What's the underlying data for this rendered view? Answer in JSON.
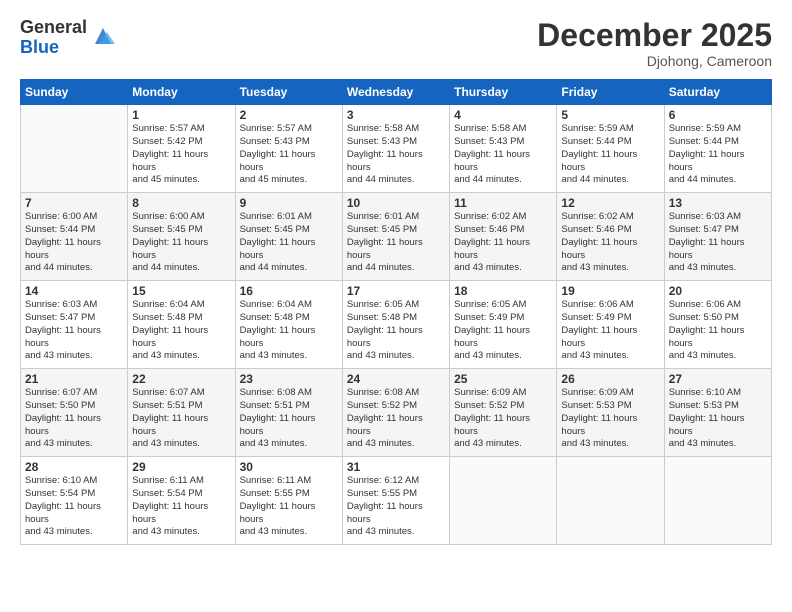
{
  "header": {
    "logo_general": "General",
    "logo_blue": "Blue",
    "month_title": "December 2025",
    "location": "Djohong, Cameroon"
  },
  "days_of_week": [
    "Sunday",
    "Monday",
    "Tuesday",
    "Wednesday",
    "Thursday",
    "Friday",
    "Saturday"
  ],
  "weeks": [
    [
      {
        "day": "",
        "sunrise": "",
        "sunset": "",
        "daylight": ""
      },
      {
        "day": "1",
        "sunrise": "Sunrise: 5:57 AM",
        "sunset": "Sunset: 5:42 PM",
        "daylight": "Daylight: 11 hours and 45 minutes."
      },
      {
        "day": "2",
        "sunrise": "Sunrise: 5:57 AM",
        "sunset": "Sunset: 5:43 PM",
        "daylight": "Daylight: 11 hours and 45 minutes."
      },
      {
        "day": "3",
        "sunrise": "Sunrise: 5:58 AM",
        "sunset": "Sunset: 5:43 PM",
        "daylight": "Daylight: 11 hours and 44 minutes."
      },
      {
        "day": "4",
        "sunrise": "Sunrise: 5:58 AM",
        "sunset": "Sunset: 5:43 PM",
        "daylight": "Daylight: 11 hours and 44 minutes."
      },
      {
        "day": "5",
        "sunrise": "Sunrise: 5:59 AM",
        "sunset": "Sunset: 5:44 PM",
        "daylight": "Daylight: 11 hours and 44 minutes."
      },
      {
        "day": "6",
        "sunrise": "Sunrise: 5:59 AM",
        "sunset": "Sunset: 5:44 PM",
        "daylight": "Daylight: 11 hours and 44 minutes."
      }
    ],
    [
      {
        "day": "7",
        "sunrise": "Sunrise: 6:00 AM",
        "sunset": "Sunset: 5:44 PM",
        "daylight": "Daylight: 11 hours and 44 minutes."
      },
      {
        "day": "8",
        "sunrise": "Sunrise: 6:00 AM",
        "sunset": "Sunset: 5:45 PM",
        "daylight": "Daylight: 11 hours and 44 minutes."
      },
      {
        "day": "9",
        "sunrise": "Sunrise: 6:01 AM",
        "sunset": "Sunset: 5:45 PM",
        "daylight": "Daylight: 11 hours and 44 minutes."
      },
      {
        "day": "10",
        "sunrise": "Sunrise: 6:01 AM",
        "sunset": "Sunset: 5:45 PM",
        "daylight": "Daylight: 11 hours and 44 minutes."
      },
      {
        "day": "11",
        "sunrise": "Sunrise: 6:02 AM",
        "sunset": "Sunset: 5:46 PM",
        "daylight": "Daylight: 11 hours and 43 minutes."
      },
      {
        "day": "12",
        "sunrise": "Sunrise: 6:02 AM",
        "sunset": "Sunset: 5:46 PM",
        "daylight": "Daylight: 11 hours and 43 minutes."
      },
      {
        "day": "13",
        "sunrise": "Sunrise: 6:03 AM",
        "sunset": "Sunset: 5:47 PM",
        "daylight": "Daylight: 11 hours and 43 minutes."
      }
    ],
    [
      {
        "day": "14",
        "sunrise": "Sunrise: 6:03 AM",
        "sunset": "Sunset: 5:47 PM",
        "daylight": "Daylight: 11 hours and 43 minutes."
      },
      {
        "day": "15",
        "sunrise": "Sunrise: 6:04 AM",
        "sunset": "Sunset: 5:48 PM",
        "daylight": "Daylight: 11 hours and 43 minutes."
      },
      {
        "day": "16",
        "sunrise": "Sunrise: 6:04 AM",
        "sunset": "Sunset: 5:48 PM",
        "daylight": "Daylight: 11 hours and 43 minutes."
      },
      {
        "day": "17",
        "sunrise": "Sunrise: 6:05 AM",
        "sunset": "Sunset: 5:48 PM",
        "daylight": "Daylight: 11 hours and 43 minutes."
      },
      {
        "day": "18",
        "sunrise": "Sunrise: 6:05 AM",
        "sunset": "Sunset: 5:49 PM",
        "daylight": "Daylight: 11 hours and 43 minutes."
      },
      {
        "day": "19",
        "sunrise": "Sunrise: 6:06 AM",
        "sunset": "Sunset: 5:49 PM",
        "daylight": "Daylight: 11 hours and 43 minutes."
      },
      {
        "day": "20",
        "sunrise": "Sunrise: 6:06 AM",
        "sunset": "Sunset: 5:50 PM",
        "daylight": "Daylight: 11 hours and 43 minutes."
      }
    ],
    [
      {
        "day": "21",
        "sunrise": "Sunrise: 6:07 AM",
        "sunset": "Sunset: 5:50 PM",
        "daylight": "Daylight: 11 hours and 43 minutes."
      },
      {
        "day": "22",
        "sunrise": "Sunrise: 6:07 AM",
        "sunset": "Sunset: 5:51 PM",
        "daylight": "Daylight: 11 hours and 43 minutes."
      },
      {
        "day": "23",
        "sunrise": "Sunrise: 6:08 AM",
        "sunset": "Sunset: 5:51 PM",
        "daylight": "Daylight: 11 hours and 43 minutes."
      },
      {
        "day": "24",
        "sunrise": "Sunrise: 6:08 AM",
        "sunset": "Sunset: 5:52 PM",
        "daylight": "Daylight: 11 hours and 43 minutes."
      },
      {
        "day": "25",
        "sunrise": "Sunrise: 6:09 AM",
        "sunset": "Sunset: 5:52 PM",
        "daylight": "Daylight: 11 hours and 43 minutes."
      },
      {
        "day": "26",
        "sunrise": "Sunrise: 6:09 AM",
        "sunset": "Sunset: 5:53 PM",
        "daylight": "Daylight: 11 hours and 43 minutes."
      },
      {
        "day": "27",
        "sunrise": "Sunrise: 6:10 AM",
        "sunset": "Sunset: 5:53 PM",
        "daylight": "Daylight: 11 hours and 43 minutes."
      }
    ],
    [
      {
        "day": "28",
        "sunrise": "Sunrise: 6:10 AM",
        "sunset": "Sunset: 5:54 PM",
        "daylight": "Daylight: 11 hours and 43 minutes."
      },
      {
        "day": "29",
        "sunrise": "Sunrise: 6:11 AM",
        "sunset": "Sunset: 5:54 PM",
        "daylight": "Daylight: 11 hours and 43 minutes."
      },
      {
        "day": "30",
        "sunrise": "Sunrise: 6:11 AM",
        "sunset": "Sunset: 5:55 PM",
        "daylight": "Daylight: 11 hours and 43 minutes."
      },
      {
        "day": "31",
        "sunrise": "Sunrise: 6:12 AM",
        "sunset": "Sunset: 5:55 PM",
        "daylight": "Daylight: 11 hours and 43 minutes."
      },
      {
        "day": "",
        "sunrise": "",
        "sunset": "",
        "daylight": ""
      },
      {
        "day": "",
        "sunrise": "",
        "sunset": "",
        "daylight": ""
      },
      {
        "day": "",
        "sunrise": "",
        "sunset": "",
        "daylight": ""
      }
    ]
  ]
}
